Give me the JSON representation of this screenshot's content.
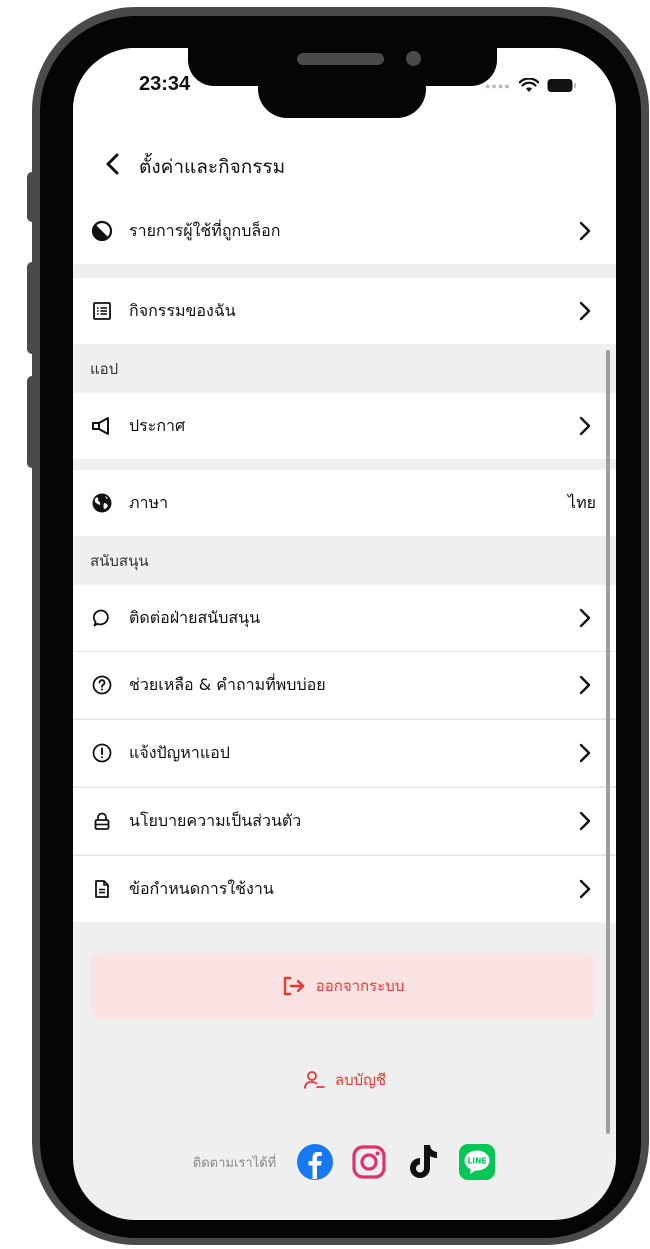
{
  "status_bar": {
    "time": "23:34"
  },
  "header": {
    "title": "ตั้งค่าและกิจกรรม"
  },
  "rows": {
    "blocked": {
      "label": "รายการผู้ใช้ที่ถูกบล็อก"
    },
    "activity": {
      "label": "กิจกรรมของฉัน"
    },
    "announcements": {
      "label": "ประกาศ"
    },
    "language": {
      "label": "ภาษา",
      "value": "ไทย"
    },
    "contact": {
      "label": "ติดต่อฝ่ายสนับสนุน"
    },
    "help": {
      "label": "ช่วยเหลือ & คำถามที่พบบ่อย"
    },
    "report": {
      "label": "แจ้งปัญหาแอป"
    },
    "privacy": {
      "label": "นโยบายความเป็นส่วนตัว"
    },
    "terms": {
      "label": "ข้อกำหนดการใช้งาน"
    }
  },
  "sections": {
    "app": "แอป",
    "support": "สนับสนุน"
  },
  "actions": {
    "logout": "ออกจากระบบ",
    "delete_account": "ลบบัญชี"
  },
  "social": {
    "follow_label": "ติดตามเราได้ที่",
    "icons": [
      "facebook-icon",
      "instagram-icon",
      "tiktok-icon",
      "line-icon"
    ]
  },
  "colors": {
    "danger": "#e53935",
    "logout_bg": "#fbe3e3",
    "facebook": "#1877f2",
    "instagram": "#e1306c",
    "line": "#06c755"
  }
}
